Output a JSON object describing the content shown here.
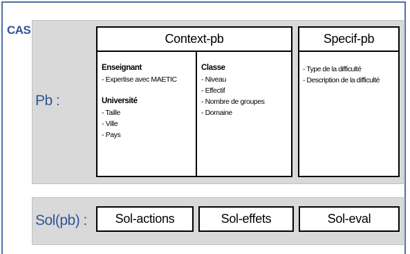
{
  "diagram": {
    "cas_label": "CAS",
    "pb_label": "Pb :",
    "sol_label": "Sol(pb) :",
    "context": {
      "title": "Context-pb",
      "enseignant": {
        "heading": "Enseignant",
        "items": [
          "- Expertise avec MAETIC"
        ]
      },
      "universite": {
        "heading": "Université",
        "items": [
          "- Taille",
          "- Ville",
          "- Pays"
        ]
      },
      "classe": {
        "heading": "Classe",
        "items": [
          "- Niveau",
          "- Effectif",
          "- Nombre de groupes",
          "- Domaine"
        ]
      }
    },
    "specif": {
      "title": "Specif-pb",
      "items": [
        "- Type de la difficulté",
        "- Description de la difficulté"
      ]
    },
    "solutions": [
      "Sol-actions",
      "Sol-effets",
      "Sol-eval"
    ]
  }
}
